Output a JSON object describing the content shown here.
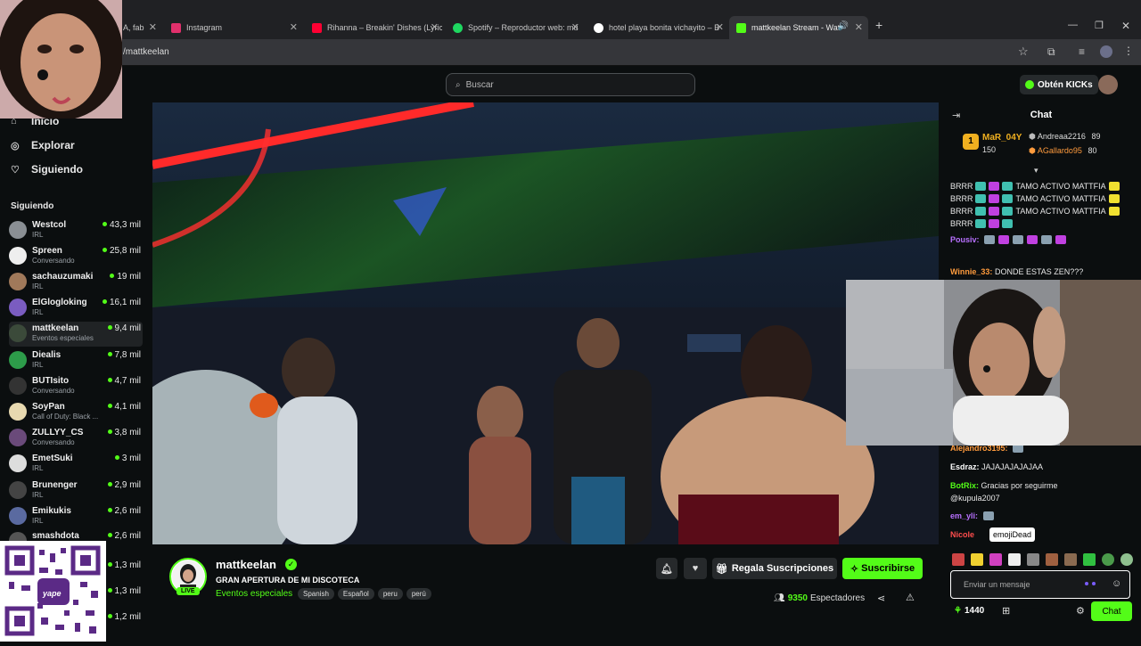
{
  "browser": {
    "tabs": [
      {
        "label": "Instagram",
        "color": "#e1306c"
      },
      {
        "label": "Rihanna – Breakin' Dishes (Lyric",
        "color": "#ff0033"
      },
      {
        "label": "Spotify – Reproductor web: mú",
        "color": "#1ed760"
      },
      {
        "label": "hotel playa bonita vichayito – B",
        "color": "#ffffff"
      },
      {
        "label": "mattkeelan Stream - Watch",
        "color": "#53fc18"
      }
    ],
    "partial_tab_label": "A, fab",
    "new_tab_symbol": "+",
    "url": "/mattkeelan"
  },
  "header": {
    "search_placeholder": "Buscar",
    "kicks_label": "Obtén KICKs"
  },
  "sidebar": {
    "nav": [
      {
        "label": "Inicio"
      },
      {
        "label": "Explorar"
      },
      {
        "label": "Siguiendo"
      }
    ],
    "section_title": "Siguiendo",
    "channels": [
      {
        "name": "Westcol",
        "category": "IRL",
        "viewers": "43,3 mil",
        "color": "#8a8f94"
      },
      {
        "name": "Spreen",
        "category": "Conversando",
        "viewers": "25,8 mil",
        "color": "#eeeeee"
      },
      {
        "name": "sachauzumaki",
        "category": "IRL",
        "viewers": "19 mil",
        "color": "#a0795a"
      },
      {
        "name": "ElGlogloking",
        "category": "IRL",
        "viewers": "16,1 mil",
        "color": "#7a5cc0"
      },
      {
        "name": "mattkeelan",
        "category": "Eventos especiales",
        "viewers": "9,4 mil",
        "color": "#3b4a3a"
      },
      {
        "name": "Diealis",
        "category": "IRL",
        "viewers": "7,8 mil",
        "color": "#2d9c4a"
      },
      {
        "name": "BUTIsito",
        "category": "Conversando",
        "viewers": "4,7 mil",
        "color": "#333333"
      },
      {
        "name": "SoyPan",
        "category": "Call of Duty: Black ...",
        "viewers": "4,1 mil",
        "color": "#e8d9b0"
      },
      {
        "name": "ZULLYY_CS",
        "category": "Conversando",
        "viewers": "3,8 mil",
        "color": "#6a4a7a"
      },
      {
        "name": "EmetSuki",
        "category": "IRL",
        "viewers": "3 mil",
        "color": "#dddddd"
      },
      {
        "name": "Brunenger",
        "category": "IRL",
        "viewers": "2,9 mil",
        "color": "#444444"
      },
      {
        "name": "Emikukis",
        "category": "IRL",
        "viewers": "2,6 mil",
        "color": "#5a6aa0"
      },
      {
        "name": "smashdota",
        "category": "",
        "viewers": "2,6 mil",
        "color": "#555555"
      }
    ],
    "extra_viewers": [
      "1,3 mil",
      "1,3 mil",
      "1,2 mil"
    ],
    "qr_caption": "yape"
  },
  "stream": {
    "streamer": "mattkeelan",
    "title": "GRAN APERTURA DE MI DISCOTECA",
    "category": "Eventos especiales",
    "tags": [
      "Spanish",
      "Español",
      "peru",
      "perú"
    ],
    "live_badge": "LIVE",
    "viewers": "9350",
    "viewers_label": "Espectadores",
    "gift_label": "Regala Suscripciones",
    "subscribe_label": "Suscribirse"
  },
  "chat": {
    "title": "Chat",
    "leaderboard": [
      {
        "rank": "1",
        "name": "MaR_04Y",
        "value": "150"
      },
      {
        "name": "Andreaa2216",
        "value": "89"
      },
      {
        "name": "AGallardo95",
        "value": "80"
      }
    ],
    "messages": [
      {
        "user": "",
        "text": "BRRR",
        "extra": "TAMO ACTIVO MATTFIA"
      },
      {
        "user": "",
        "text": "BRRR",
        "extra": "TAMO ACTIVO MATTFIA"
      },
      {
        "user": "",
        "text": "BRRR",
        "extra": "TAMO ACTIVO MATTFIA"
      },
      {
        "user": "",
        "text": "BRRR",
        "extra": ""
      },
      {
        "user": "Pousiv:",
        "text": "",
        "extra": ""
      },
      {
        "user": "Winnie_33:",
        "text": "DONDE ESTAS ZEN???",
        "extra": ""
      },
      {
        "user": "Alejandro3195:",
        "text": "",
        "extra": ""
      },
      {
        "user": "Esdraz:",
        "text": "JAJAJAJAJAJAA",
        "extra": ""
      },
      {
        "user": "BotRix:",
        "text": "Gracias por seguirme",
        "extra": ""
      },
      {
        "user": "",
        "text": "@kupula2007",
        "extra": ""
      },
      {
        "user": "em_yli:",
        "text": "",
        "extra": ""
      },
      {
        "user": "Nicole",
        "text": "",
        "extra": ""
      }
    ],
    "tooltip": "emojiDead",
    "input_placeholder": "Enviar un mensaje",
    "points": "1440",
    "send_label": "Chat",
    "colors": {
      "accent": "#53fc18",
      "username_green": "#53fc18",
      "username_orange": "#ff9b3d",
      "username_purple": "#b870ff",
      "username_red": "#ff4d4d"
    }
  }
}
